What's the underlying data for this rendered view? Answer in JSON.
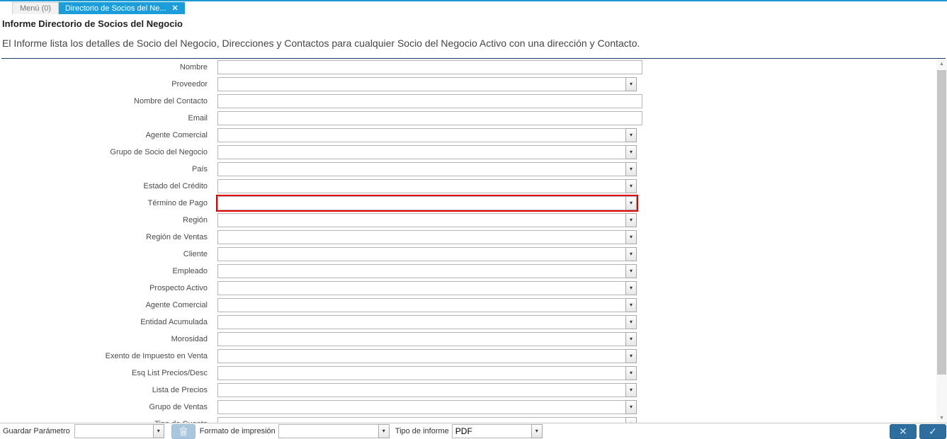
{
  "tab_bar": {
    "tabs": [
      {
        "label": "Menú (0)",
        "active": false
      },
      {
        "label": "Directorio de Socios del Ne...",
        "active": true
      }
    ],
    "close_icon": "✕"
  },
  "header": {
    "title": "Informe Directorio de Socios del Negocio",
    "description": "El Informe lista los detalles de Socio del Negocio, Direcciones y Contactos para cualquier Socio del Negocio Activo con una dirección y Contacto."
  },
  "form": {
    "rows": [
      {
        "name": "nombre",
        "label": "Nombre",
        "type": "text",
        "value": ""
      },
      {
        "name": "proveedor",
        "label": "Proveedor",
        "type": "combo",
        "value": ""
      },
      {
        "name": "nombre-del-contacto",
        "label": "Nombre del Contacto",
        "type": "text",
        "value": ""
      },
      {
        "name": "email",
        "label": "Email",
        "type": "text",
        "value": ""
      },
      {
        "name": "agente-comercial",
        "label": "Agente Comercial",
        "type": "combo",
        "value": ""
      },
      {
        "name": "grupo-de-socio-del-negocio",
        "label": "Grupo de Socio del Negocio",
        "type": "combo",
        "value": ""
      },
      {
        "name": "pais",
        "label": "País",
        "type": "combo",
        "value": ""
      },
      {
        "name": "estado-del-credito",
        "label": "Estado del Crédito",
        "type": "combo",
        "value": ""
      },
      {
        "name": "termino-de-pago",
        "label": "Término de Pago",
        "type": "combo",
        "value": "",
        "highlighted": true
      },
      {
        "name": "region",
        "label": "Región",
        "type": "combo",
        "value": ""
      },
      {
        "name": "region-de-ventas",
        "label": "Región de Ventas",
        "type": "combo",
        "value": ""
      },
      {
        "name": "cliente",
        "label": "Cliente",
        "type": "combo",
        "value": ""
      },
      {
        "name": "empleado",
        "label": "Empleado",
        "type": "combo",
        "value": ""
      },
      {
        "name": "prospecto-activo",
        "label": "Prospecto Activo",
        "type": "combo",
        "value": ""
      },
      {
        "name": "agente-comercial-2",
        "label": "Agente Comercial",
        "type": "combo",
        "value": ""
      },
      {
        "name": "entidad-acumulada",
        "label": "Entidad Acumulada",
        "type": "combo",
        "value": ""
      },
      {
        "name": "morosidad",
        "label": "Morosidad",
        "type": "combo",
        "value": ""
      },
      {
        "name": "exento-de-impuesto-en-venta",
        "label": "Exento de Impuesto en Venta",
        "type": "combo",
        "value": ""
      },
      {
        "name": "esq-list-precios-desc",
        "label": "Esq List Precios/Desc",
        "type": "combo",
        "value": ""
      },
      {
        "name": "lista-de-precios",
        "label": "Lista de Precios",
        "type": "combo",
        "value": ""
      },
      {
        "name": "grupo-de-ventas",
        "label": "Grupo de Ventas",
        "type": "combo",
        "value": ""
      },
      {
        "name": "tipo-de-cuenta",
        "label": "Tipo de Cuenta",
        "type": "combo",
        "value": ""
      }
    ]
  },
  "footer": {
    "save_param_label": "Guardar Parámetro",
    "save_param_value": "",
    "print_format_label": "Formato de impresión",
    "print_format_value": "",
    "report_type_label": "Tipo de informe",
    "report_type_value": "PDF"
  },
  "icons": {
    "dropdown_arrow": "▾",
    "close": "✕",
    "cancel": "✕",
    "ok": "✓",
    "scroll_up": "▲",
    "scroll_down": "▼"
  },
  "colors": {
    "accent_tab": "#1b9dd9",
    "separator": "#1c3f63",
    "highlight": "#e60000",
    "action_button": "#2d6e9e",
    "trash_button": "#a9c6dc"
  }
}
